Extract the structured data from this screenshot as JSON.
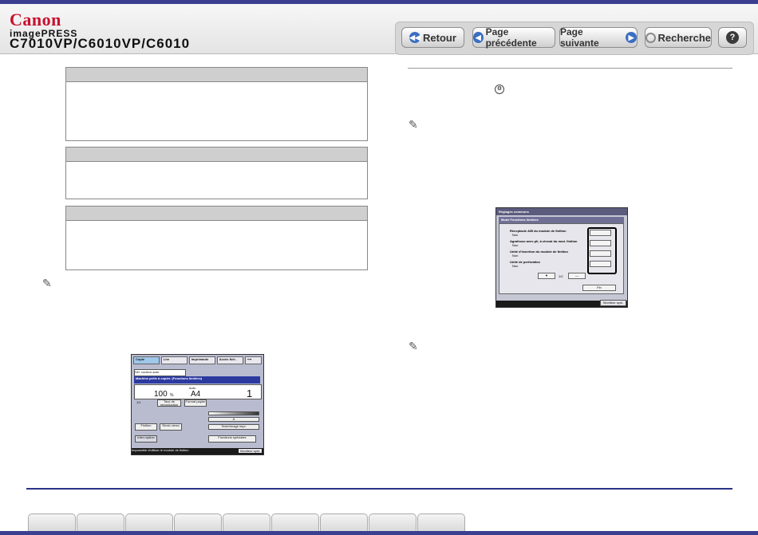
{
  "header": {
    "brand": "Canon",
    "subbrand": "imagePRESS",
    "model": "C7010VP/C6010VP/C6010"
  },
  "nav": {
    "back": "Retour",
    "prev": "Page précédente",
    "next": "Page suivante",
    "search": "Recherche",
    "help": "?"
  },
  "left_screen": {
    "tabs": [
      "Copie",
      "Lire",
      "Imprimante",
      "Accès fich."
    ],
    "selector": "Sél. couleur auto",
    "message": "Machine prête à copier. (Fonctions limitées)",
    "zoom": "100",
    "zoom_unit": "%",
    "paper": "A4",
    "paper_mode": "Auto",
    "count": "1",
    "ratio": "1/1",
    "btn_ratio": "Taux de reproduction",
    "btn_paper": "Format papier",
    "btn_finish": "Finition",
    "btn_duplex": "Recto verso",
    "btn_interrupt": "Inter-ruption",
    "btn_special": "Fonctions spéciales",
    "btn_text": "Texte/Image impr.",
    "btn_density": "A",
    "error": "Impossible d'utiliser le module de finition",
    "monitor": "Moniteur syst."
  },
  "right_screen": {
    "title": "Réglages communs",
    "subtitle": "Mode Fonctions limitées",
    "items": [
      {
        "label": "Réceptacle A/B du module de finition",
        "value": "Non"
      },
      {
        "label": "Agrafeuse avec pli, à cheval du mod. finition",
        "value": "Non"
      },
      {
        "label": "Unité d'insertion du module de finition",
        "value": "Non"
      },
      {
        "label": "Unité de perforation",
        "value": "Non"
      }
    ],
    "page": "1/2",
    "done": "Fin",
    "monitor": "Moniteur syst."
  }
}
